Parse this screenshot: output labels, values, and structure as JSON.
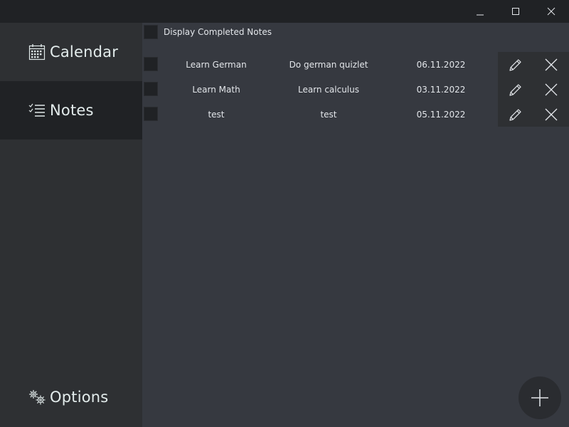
{
  "titlebar": {
    "minimize_icon": "minimize-icon",
    "maximize_icon": "maximize-icon",
    "close_icon": "close-icon"
  },
  "sidebar": {
    "items": [
      {
        "label": "Calendar",
        "icon": "calendar-icon",
        "selected": false
      },
      {
        "label": "Notes",
        "icon": "checklist-icon",
        "selected": true
      },
      {
        "label": "Options",
        "icon": "gears-icon",
        "selected": false
      }
    ]
  },
  "notes": {
    "display_completed_label": "Display Completed Notes",
    "rows": [
      {
        "title": "Learn German",
        "description": "Do german quizlet",
        "date": "06.11.2022"
      },
      {
        "title": "Learn Math",
        "description": "Learn calculus",
        "date": "03.11.2022"
      },
      {
        "title": "test",
        "description": "test",
        "date": "05.11.2022"
      }
    ],
    "edit_icon": "pencil-icon",
    "delete_icon": "close-icon"
  },
  "fab": {
    "icon": "plus-icon"
  },
  "colors": {
    "background": "#363940",
    "sidebar": "#2e3033",
    "selected": "#202225",
    "titlebar": "#202225",
    "text": "#e3e6ea"
  }
}
